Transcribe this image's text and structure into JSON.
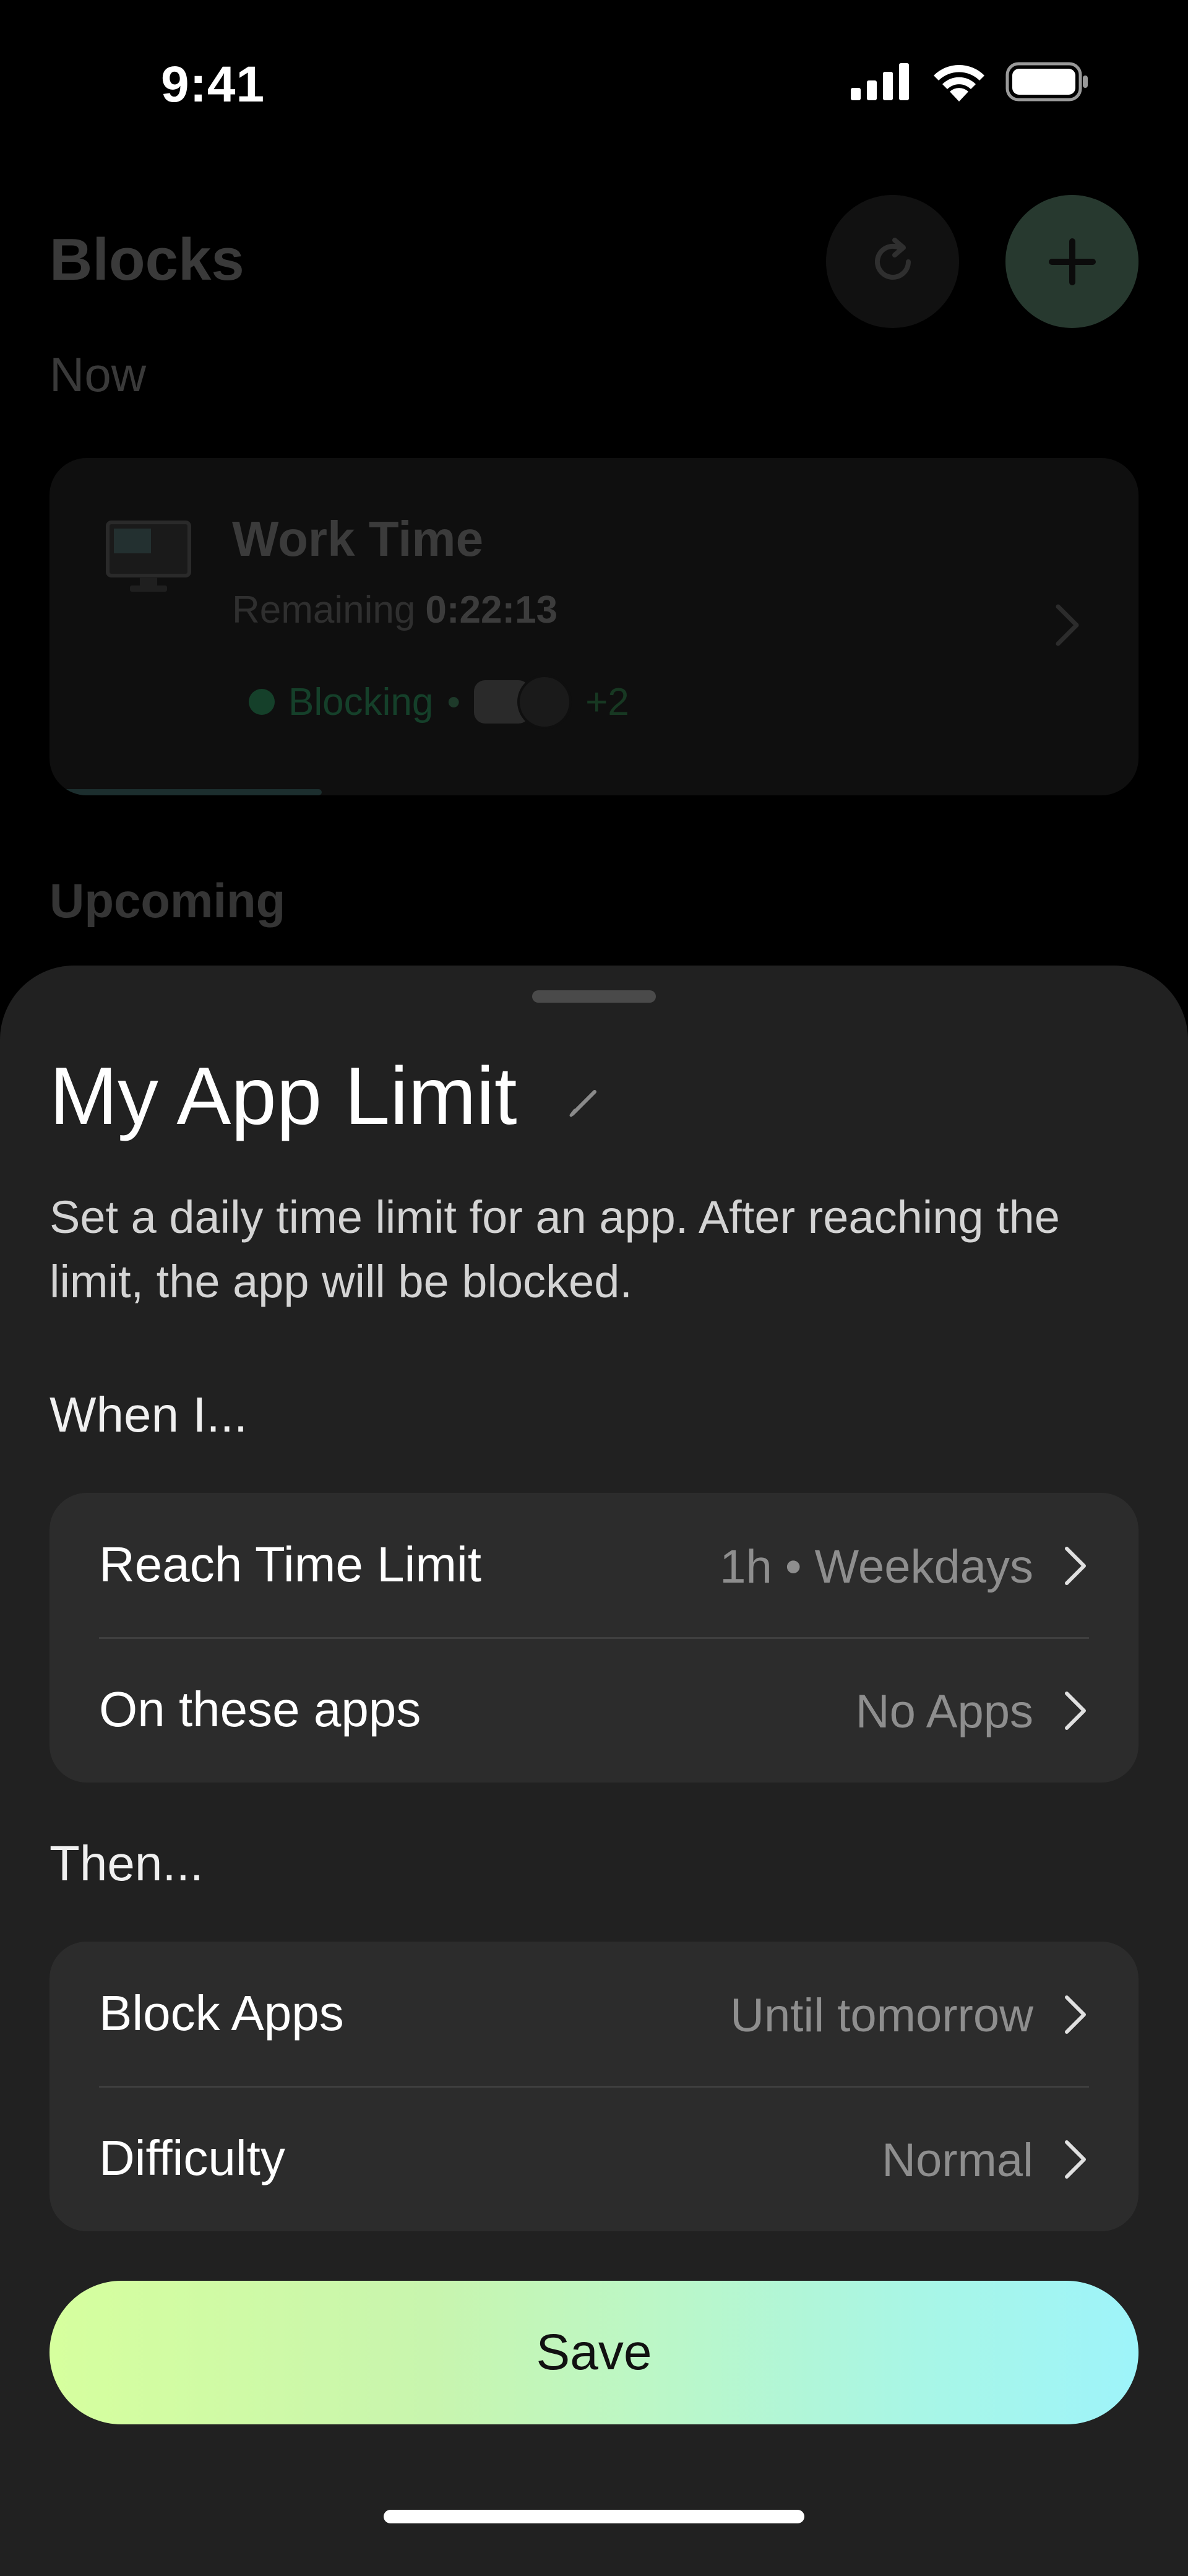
{
  "status_bar": {
    "time": "9:41"
  },
  "background": {
    "title": "Blocks",
    "now_label": "Now",
    "card": {
      "title": "Work Time",
      "remaining_label": "Remaining",
      "remaining_value": "0:22:13",
      "status": "Blocking",
      "extra_apps": "+2",
      "progress_fraction": 0.25
    },
    "upcoming_label": "Upcoming"
  },
  "sheet": {
    "title": "My App Limit",
    "description": "Set a daily time limit for an app. After reaching the limit, the app will be blocked.",
    "when_label": "When I...",
    "when_rows": [
      {
        "label": "Reach Time Limit",
        "value": "1h • Weekdays"
      },
      {
        "label": "On these apps",
        "value": "No Apps"
      }
    ],
    "then_label": "Then...",
    "then_rows": [
      {
        "label": "Block Apps",
        "value": "Until tomorrow"
      },
      {
        "label": "Difficulty",
        "value": "Normal"
      }
    ],
    "save_label": "Save"
  },
  "colors": {
    "accent_green": "#27392f",
    "save_gradient_start": "#d6ff9e",
    "save_gradient_end": "#9ef4fa"
  }
}
